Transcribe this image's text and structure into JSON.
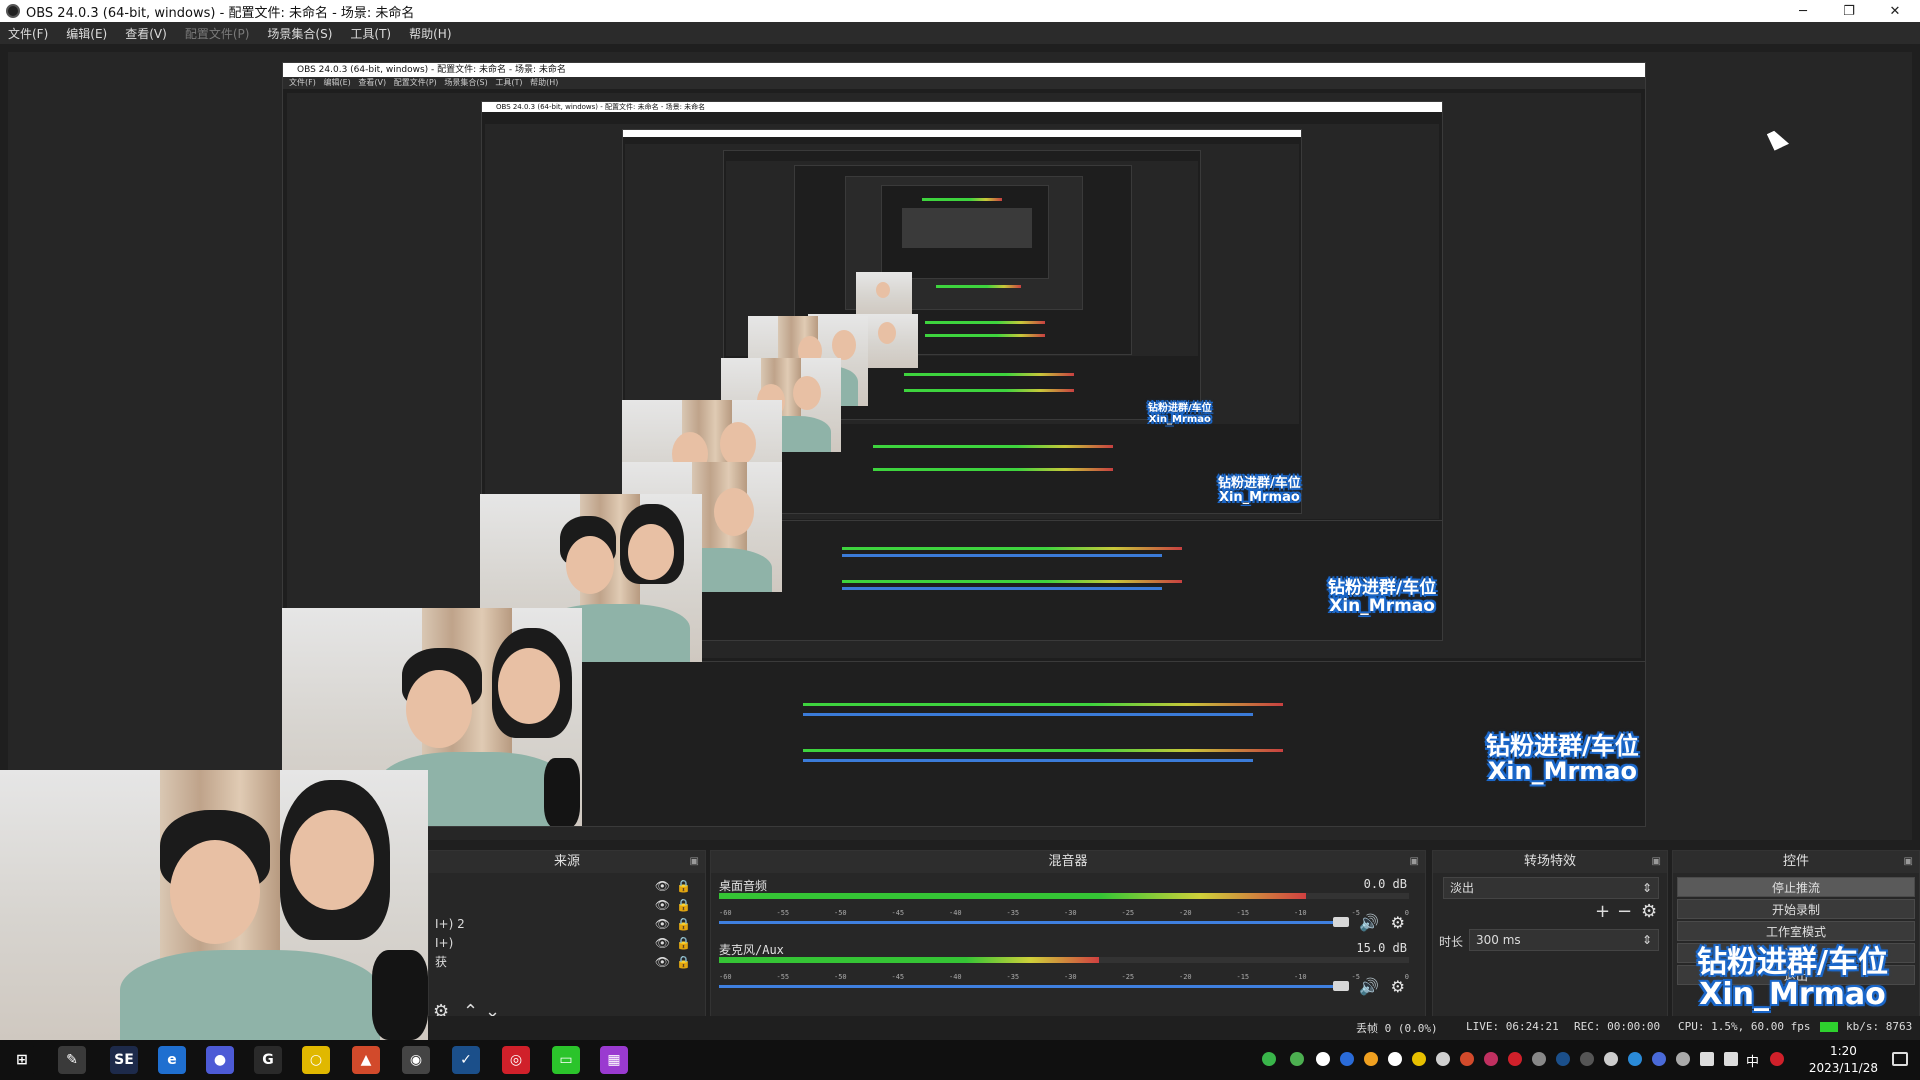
{
  "window": {
    "title": "OBS 24.0.3 (64-bit, windows) - 配置文件: 未命名 - 场景: 未命名",
    "minimize": "─",
    "maximize": "❐",
    "close": "✕"
  },
  "menu": [
    {
      "label": "文件(F)",
      "disabled": false
    },
    {
      "label": "编辑(E)",
      "disabled": false
    },
    {
      "label": "查看(V)",
      "disabled": false
    },
    {
      "label": "配置文件(P)",
      "disabled": true
    },
    {
      "label": "场景集合(S)",
      "disabled": false
    },
    {
      "label": "工具(T)",
      "disabled": false
    },
    {
      "label": "帮助(H)",
      "disabled": false
    }
  ],
  "docks": {
    "sources": {
      "title": "来源",
      "items": [
        {
          "label": ""
        },
        {
          "label": ""
        },
        {
          "label": "I+) 2"
        },
        {
          "label": "I+)"
        },
        {
          "label": "获"
        }
      ]
    },
    "mixer": {
      "title": "混音器",
      "channels": [
        {
          "name": "桌面音频",
          "db": "0.0 dB",
          "level": 0.85,
          "volume": 0.95
        },
        {
          "name": "麦克风/Aux",
          "db": "15.0 dB",
          "level": 0.55,
          "volume": 0.95
        }
      ],
      "ticks": [
        "-60",
        "-55",
        "-50",
        "-45",
        "-40",
        "-35",
        "-30",
        "-25",
        "-20",
        "-15",
        "-10",
        "-5",
        "0"
      ]
    },
    "transitions": {
      "title": "转场特效",
      "selected": "淡出",
      "duration_label": "时长",
      "duration_value": "300 ms"
    },
    "controls": {
      "title": "控件",
      "buttons": [
        "停止推流",
        "开始录制",
        "工作室模式",
        "设置",
        "退出"
      ]
    }
  },
  "watermark": {
    "line1": "钻粉进群/车位",
    "line2": "Xin_Mrmao"
  },
  "status": {
    "dropped": "丢帧 0 (0.0%)",
    "live": "LIVE: 06:24:21",
    "rec": "REC: 00:00:00",
    "cpu": "CPU: 1.5%, 60.00 fps",
    "kbps": "kb/s: 8763"
  },
  "taskbar": {
    "time": "1:20",
    "date": "2023/11/28",
    "ime": "中",
    "apps": [
      {
        "name": "start-icon",
        "color": "#101010",
        "label": "⊞"
      },
      {
        "name": "app-pen-icon",
        "color": "#3a3a3a",
        "label": "✎"
      },
      {
        "name": "app-se-icon",
        "color": "#1d2a4a",
        "label": "SE"
      },
      {
        "name": "app-edge-icon",
        "color": "#1f6fd0",
        "label": "e"
      },
      {
        "name": "app-firefox-icon",
        "color": "#4d5bd6",
        "label": "●"
      },
      {
        "name": "app-google-icon",
        "color": "#2a2a2a",
        "label": "G"
      },
      {
        "name": "app-chrome-icon",
        "color": "#e0b800",
        "label": "○"
      },
      {
        "name": "app-fox-icon",
        "color": "#d24a2b",
        "label": "▲"
      },
      {
        "name": "app-obs-icon",
        "color": "#444444",
        "label": "◉"
      },
      {
        "name": "app-steam-icon",
        "color": "#1b4f8a",
        "label": "✓"
      },
      {
        "name": "app-netease-icon",
        "color": "#d0202a",
        "label": "◎"
      },
      {
        "name": "app-iqiyi-icon",
        "color": "#2bc42b",
        "label": "▭"
      },
      {
        "name": "app-media-icon",
        "color": "#9a3ad0",
        "label": "▦"
      }
    ]
  }
}
